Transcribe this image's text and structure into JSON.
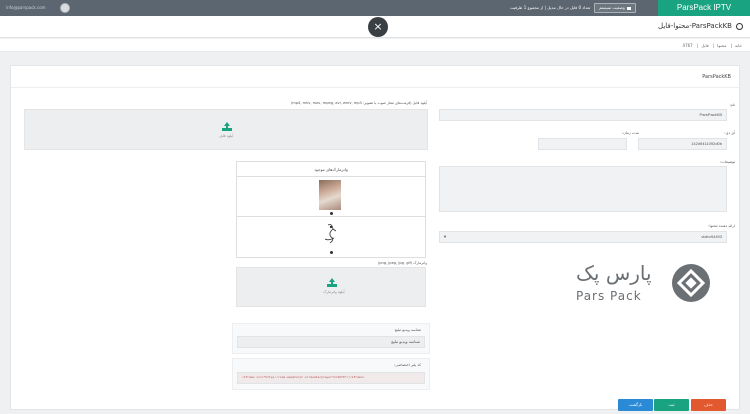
{
  "topbar": {
    "brand": "ParsPack IPTV",
    "system_status": "وضعیت سیستم",
    "conversion_status": "تعداد 0 فایل در حال تبدیل | از مجموع 1 ظرفیت",
    "user_name": "info@parspack.com"
  },
  "header": {
    "title": "محتوا-فایل-ParsPackKB",
    "close": "×"
  },
  "breadcrumb": [
    "خانه",
    "محتوا",
    "فایل",
    "4767"
  ],
  "card": {
    "title": "ParsPackKB",
    "name_label": "نام:",
    "name_value": "ParsPackKB",
    "id_label": "آی دی:",
    "id_value": "142d9411092d0b",
    "duration_label": "مدت زمان:",
    "duration_value": "",
    "description_label": "توضیحات:",
    "description_value": "",
    "provider_label": "ارائه دهنده محتوا:",
    "provider_value": "video94493",
    "upload_label": "آپلود فایل (فرمت‌های مجاز صوت یا تصویر: mp4, mkv, mov, mpeg, avi, wmv, mp3)",
    "upload_button": "آپلود فایل",
    "posters_title": "واترمارک‌های موجود",
    "poster_upload_label": "واترمارک (png, jpeg, jpg, gif)",
    "poster_upload_button": "آپلود واترمارک",
    "tag_label": "شناسه ویدیو تبلیغ",
    "tag_placeholder": "شناسه ویدیو تبلیغ",
    "embed_label": "کد پلیر اختصاصی:",
    "embed_code": "<iframe src=\"https://cod.aapaterpr.ir/media/player?v=4676\"></iframe>"
  },
  "logo": {
    "fa": "پارس پک",
    "en": "Pars Pack"
  },
  "actions": {
    "cancel": "حذف",
    "save": "ثبت",
    "back": "بازگشت",
    "cancel_color": "#e3592f",
    "save_color": "#1aa381",
    "back_color": "#2b8ad6"
  }
}
